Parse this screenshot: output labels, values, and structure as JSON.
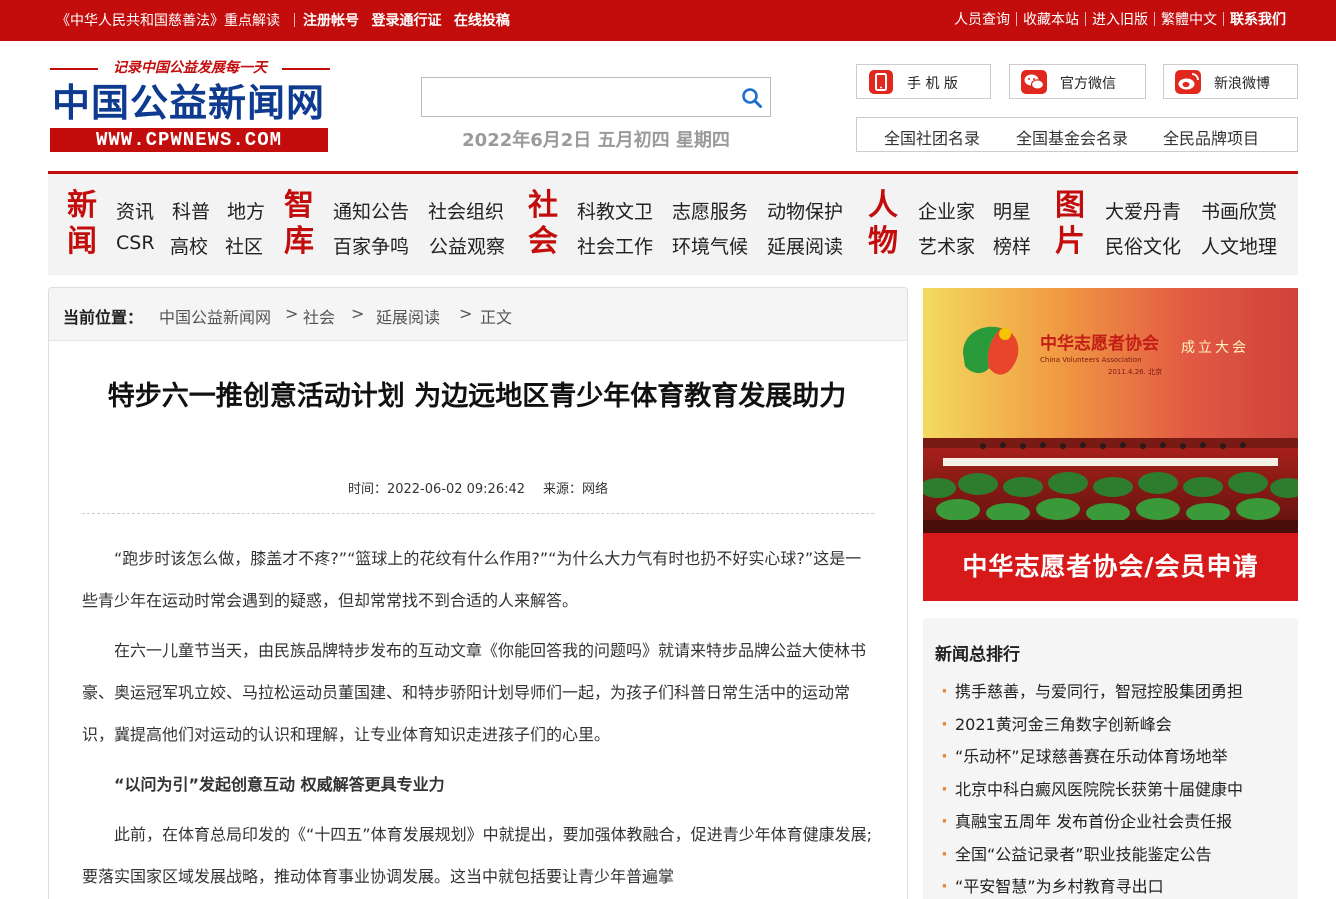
{
  "topbar": {
    "left": [
      "《中华人民共和国慈善法》重点解读",
      "注册帐号",
      "登录通行证",
      "在线投稿"
    ],
    "right": [
      "人员查询",
      "收藏本站",
      "进入旧版",
      "繁體中文",
      "联系我们"
    ]
  },
  "logo": {
    "slogan": "记录中国公益发展每一天",
    "name": "中国公益新闻网",
    "url": "WWW.CPWNEWS.COM"
  },
  "search": {
    "value": "",
    "placeholder": ""
  },
  "date": "2022年6月2日 五月初四 星期四",
  "quick": [
    {
      "label": "手 机 版",
      "icon": "mobile-icon",
      "color": "#e0281e"
    },
    {
      "label": "官方微信",
      "icon": "wechat-icon",
      "color": "#e0281e"
    },
    {
      "label": "新浪微博",
      "icon": "weibo-icon",
      "color": "#e0281e"
    }
  ],
  "directories": [
    "全国社团名录",
    "全国基金会名录",
    "全民品牌项目"
  ],
  "nav": {
    "categories": [
      {
        "name": "新闻",
        "links": [
          [
            "资讯",
            "科普",
            "地方"
          ],
          [
            "CSR",
            "高校",
            "社区"
          ]
        ]
      },
      {
        "name": "智库",
        "links": [
          [
            "通知公告",
            "社会组织"
          ],
          [
            "百家争鸣",
            "公益观察"
          ]
        ]
      },
      {
        "name": "社会",
        "links": [
          [
            "科教文卫",
            "志愿服务",
            "动物保护"
          ],
          [
            "社会工作",
            "环境气候",
            "延展阅读"
          ]
        ]
      },
      {
        "name": "人物",
        "links": [
          [
            "企业家",
            "明星"
          ],
          [
            "艺术家",
            "榜样"
          ]
        ]
      },
      {
        "name": "图片",
        "links": [
          [
            "大爱丹青",
            "书画欣赏"
          ],
          [
            "民俗文化",
            "人文地理"
          ]
        ]
      }
    ]
  },
  "breadcrumb": {
    "label": "当前位置：",
    "items": [
      "中国公益新闻网",
      "社会",
      "延展阅读",
      "正文"
    ],
    "separator": ">"
  },
  "article": {
    "title": "特步六一推创意活动计划 为边远地区青少年体育教育发展助力",
    "time": "时间：2022-06-02 09:26:42",
    "source": "来源：网络",
    "paragraphs": [
      "“跑步时该怎么做，膝盖才不疼?”“篮球上的花纹有什么作用?”“为什么大力气有时也扔不好实心球?”这是一些青少年在运动时常会遇到的疑惑，但却常常找不到合适的人来解答。",
      "在六一儿童节当天，由民族品牌特步发布的互动文章《你能回答我的问题吗》就请来特步品牌公益大使林书豪、奥运冠军巩立姣、马拉松运动员董国建、和特步骄阳计划导师们一起，为孩子们科普日常生活中的运动常识，冀提高他们对运动的认识和理解，让专业体育知识走进孩子们的心里。",
      "“以问为引”发起创意互动 权威解答更具专业力",
      "此前，在体育总局印发的《“十四五”体育发展规划》中就提出，要加强体教融合，促进青少年体育健康发展;要落实国家区域发展战略，推动体育事业协调发展。这当中就包括要让青少年普遍掌"
    ]
  },
  "banner": {
    "logo_text": "中华志愿者协会",
    "logo_sub": "China Volunteers Association",
    "event": "成立大会",
    "date": "2011.4.26. 北京",
    "caption": "中华志愿者协会/会员申请"
  },
  "ranking": {
    "title": "新闻总排行",
    "items": [
      "携手慈善，与爱同行，智冠控股集团勇担",
      "2021黄河金三角数字创新峰会",
      "“乐动杯”足球慈善赛在乐动体育场地举",
      "北京中科白癜风医院院长获第十届健康中",
      "真融宝五周年 发布首份企业社会责任报",
      "全国“公益记录者”职业技能鉴定公告",
      "“平安智慧”为乡村教育寻出口"
    ]
  }
}
